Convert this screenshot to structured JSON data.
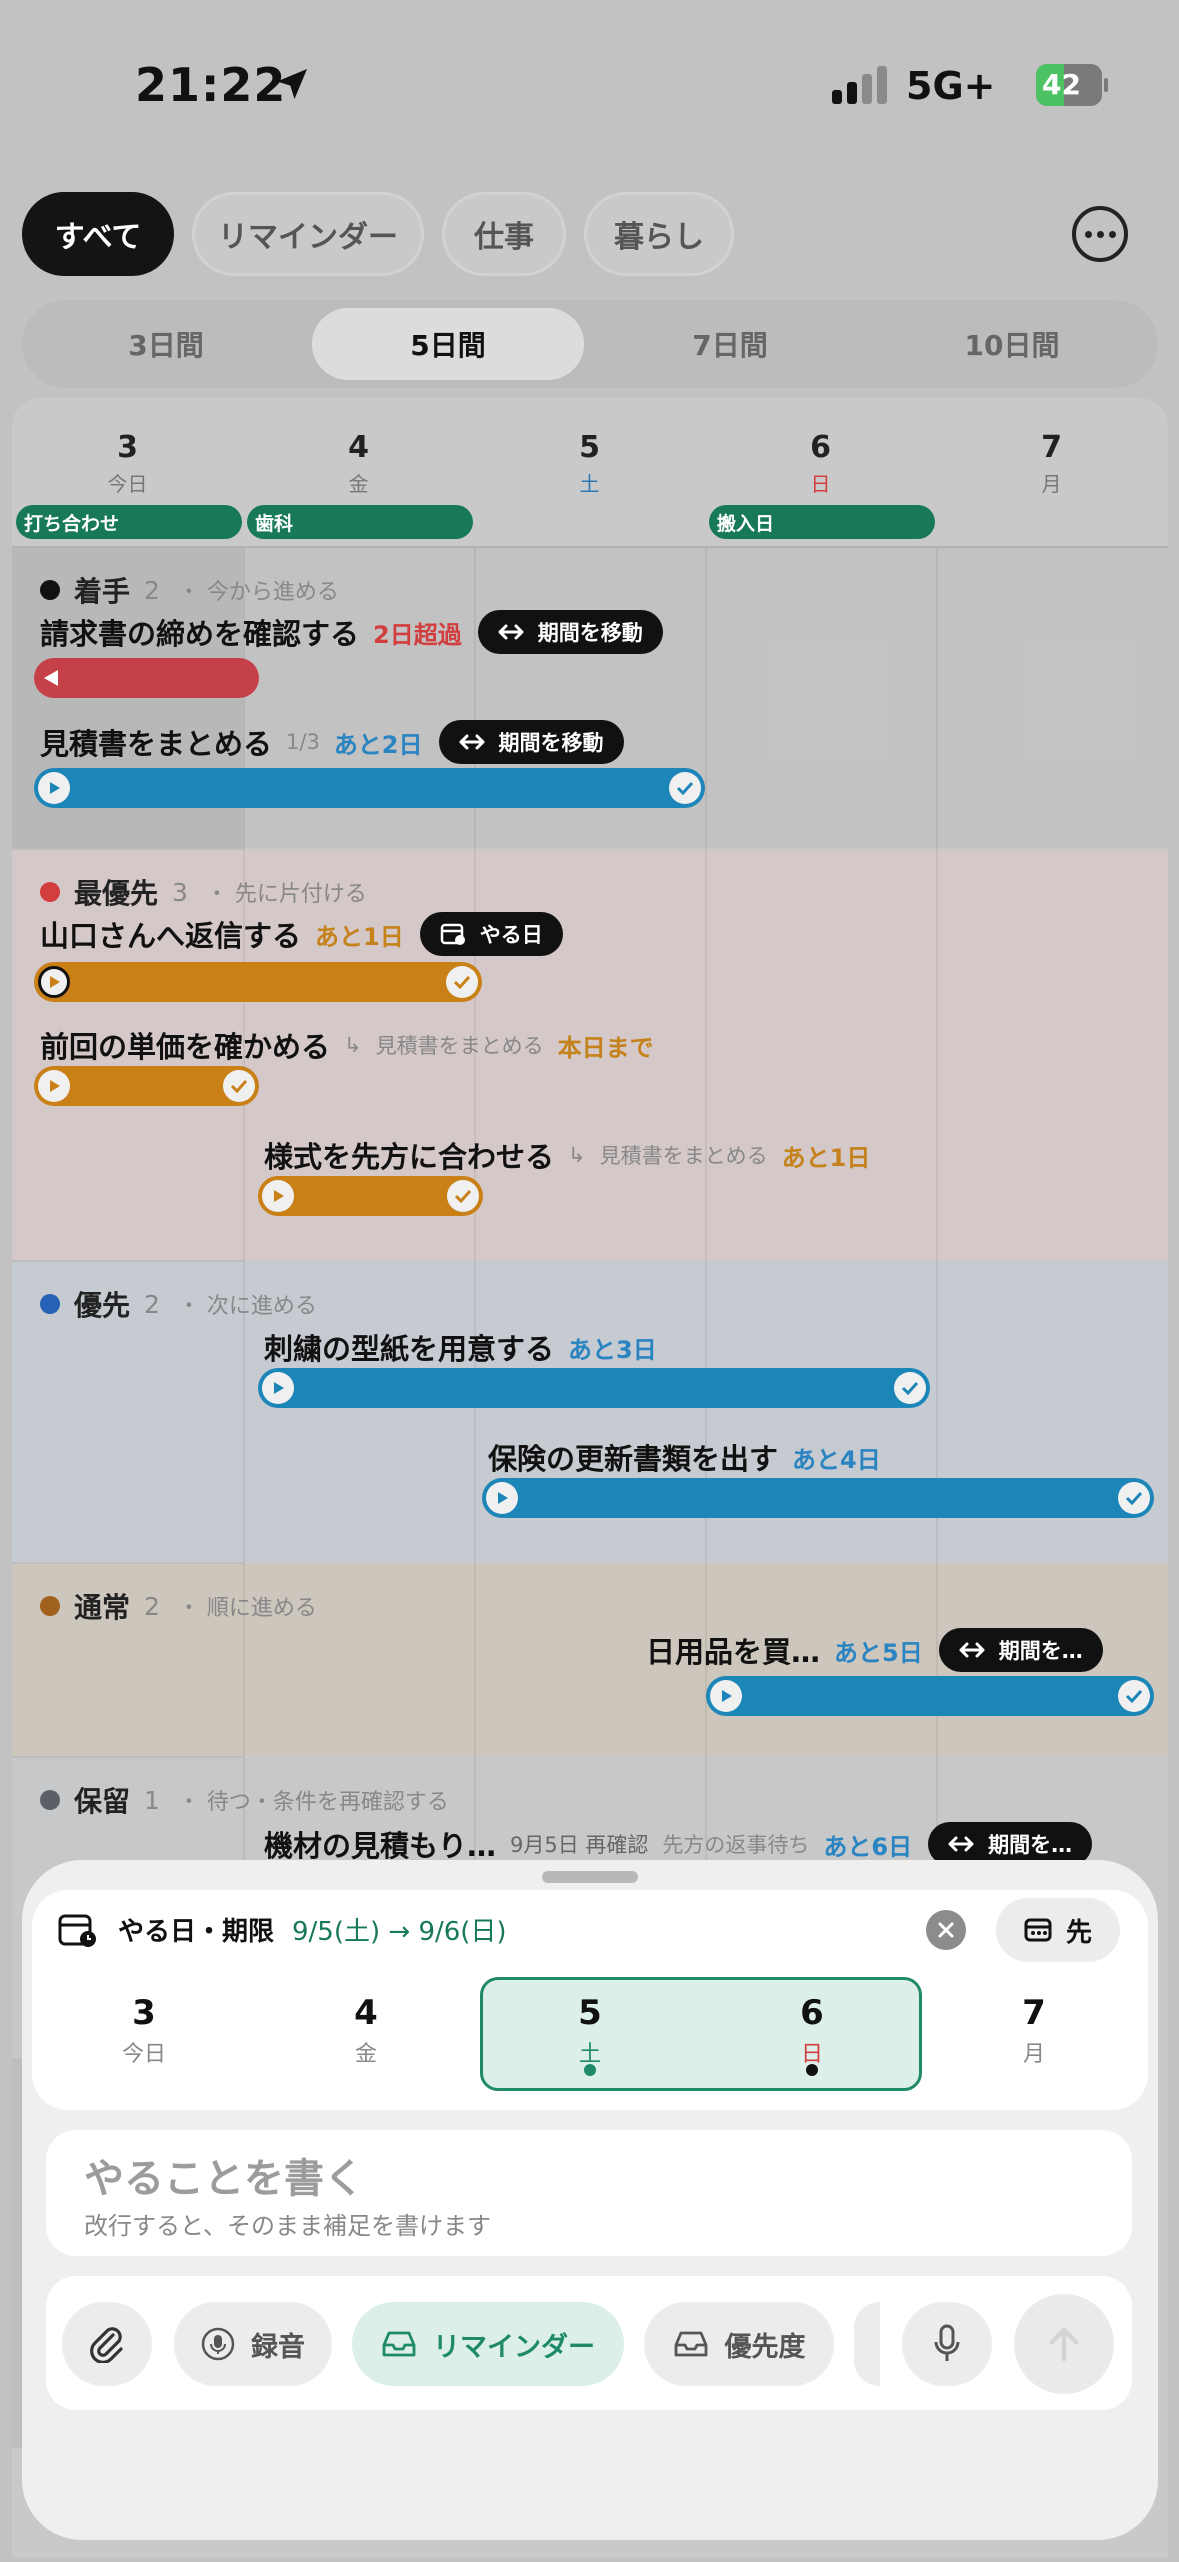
{
  "status": {
    "time": "21:22",
    "network": "5G+",
    "battery": "42",
    "battery_level": 0.42
  },
  "filters": [
    "すべて",
    "リマインダー",
    "仕事",
    "暮らし"
  ],
  "ranges": [
    "3日間",
    "5日間",
    "7日間",
    "10日間"
  ],
  "days": [
    {
      "num": "3",
      "sub": "今日"
    },
    {
      "num": "4",
      "sub": "金"
    },
    {
      "num": "5",
      "sub": "土"
    },
    {
      "num": "6",
      "sub": "日"
    },
    {
      "num": "7",
      "sub": "月"
    }
  ],
  "events": [
    "打ち合わせ",
    "歯科",
    "搬入日"
  ],
  "sections": {
    "chakushu": {
      "name": "着手",
      "count": "2",
      "desc": "・ 今から進める",
      "color": "#111111",
      "tasks": [
        {
          "title": "請求書の締めを確認する",
          "due": "2日超過",
          "pill": "期間を移動"
        },
        {
          "title": "見積書をまとめる",
          "sub": "1/3",
          "due": "あと2日",
          "pill": "期間を移動"
        }
      ]
    },
    "saiyusen": {
      "name": "最優先",
      "count": "3",
      "desc": "・ 先に片付ける",
      "color": "#d23e3e",
      "tasks": [
        {
          "title": "山口さんへ返信する",
          "due": "あと1日",
          "pill": "やる日"
        },
        {
          "title": "前回の単価を確かめる",
          "parent": "見積書をまとめる",
          "due": "本日まで"
        },
        {
          "title": "様式を先方に合わせる",
          "parent": "見積書をまとめる",
          "due": "あと1日"
        }
      ]
    },
    "yusen": {
      "name": "優先",
      "count": "2",
      "desc": "・ 次に進める",
      "color": "#2662b3",
      "tasks": [
        {
          "title": "刺繍の型紙を用意する",
          "due": "あと3日"
        },
        {
          "title": "保険の更新書類を出す",
          "due": "あと4日"
        }
      ]
    },
    "tsujo": {
      "name": "通常",
      "count": "2",
      "desc": "・ 順に進める",
      "color": "#a0601e",
      "tasks": [
        {
          "title": "日用品を買…",
          "due": "あと5日",
          "pill": "期間を…"
        }
      ]
    },
    "horyu": {
      "name": "保留",
      "count": "1",
      "desc": "・ 待つ・条件を再確認する",
      "color": "#5a6066",
      "tasks": [
        {
          "title": "機材の見積もり…",
          "note1": "9月5日 再確認",
          "note2": "先方の返事待ち",
          "due": "あと6日",
          "pill": "期間を…"
        }
      ]
    }
  },
  "sheet": {
    "title": "やる日・期限",
    "range": "9/5(土) → 9/6(日)",
    "saki": "先",
    "input_placeholder": "やることを書く",
    "input_hint": "改行すると、そのまま補足を書けます",
    "tools": [
      "録音",
      "リマインダー",
      "優先度"
    ]
  },
  "icons": [
    "location-arrow-icon",
    "more-icon",
    "play-icon",
    "check-icon",
    "swap-arrows-icon",
    "calendar-icon",
    "close-icon",
    "paperclip-icon",
    "mic-icon",
    "tray-icon",
    "send-arrow-icon"
  ]
}
